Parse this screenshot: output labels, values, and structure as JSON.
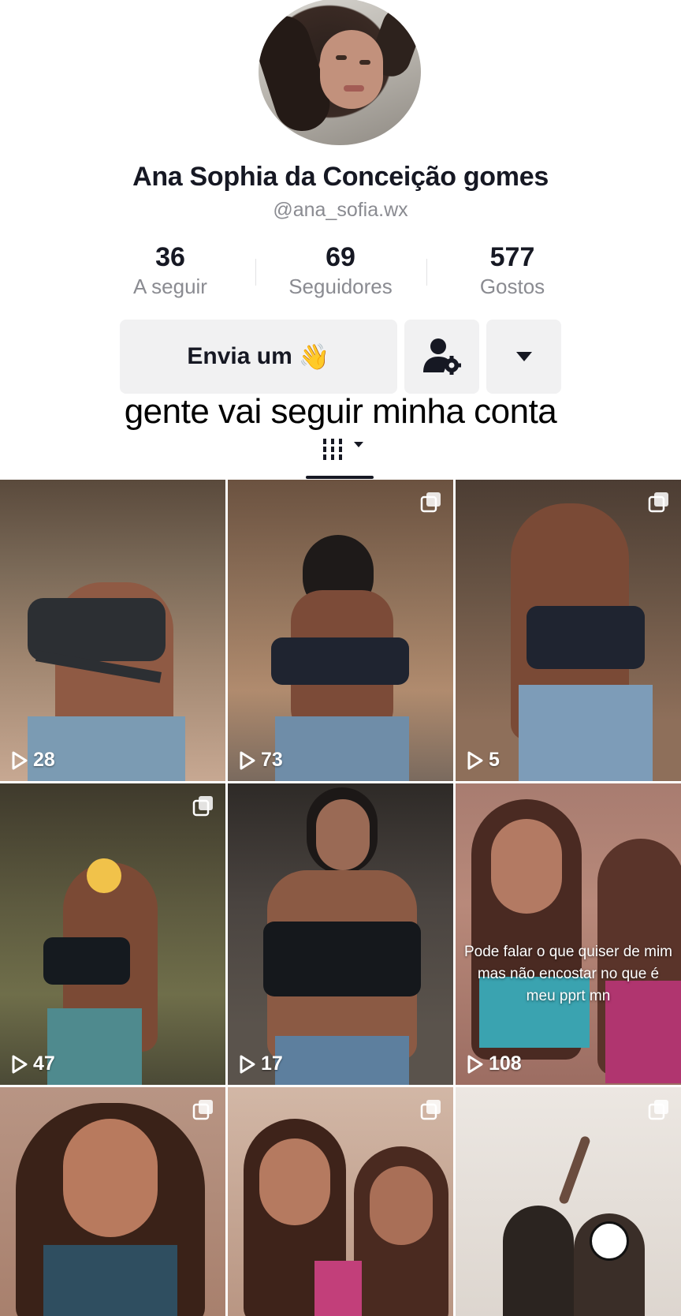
{
  "profile": {
    "name": "Ana Sophia da Conceição gomes",
    "handle": "@ana_sofia.wx",
    "stats": [
      {
        "value": "36",
        "label": "A seguir"
      },
      {
        "value": "69",
        "label": "Seguidores"
      },
      {
        "value": "577",
        "label": "Gostos"
      }
    ]
  },
  "actions": {
    "message_label": "Envia um",
    "message_emoji": "👋",
    "user_settings_icon": "user-gear-icon",
    "more_icon": "caret-down-icon"
  },
  "caption": "gente vai seguir minha conta",
  "videos": [
    {
      "views": "28",
      "multi": false,
      "overlay": ""
    },
    {
      "views": "73",
      "multi": true,
      "overlay": ""
    },
    {
      "views": "5",
      "multi": true,
      "overlay": ""
    },
    {
      "views": "47",
      "multi": true,
      "overlay": ""
    },
    {
      "views": "17",
      "multi": false,
      "overlay": ""
    },
    {
      "views": "108",
      "multi": false,
      "overlay": "Pode falar o que quiser de mim mas não encostar no que é meu pprt mn"
    },
    {
      "views": "",
      "multi": true,
      "overlay": ""
    },
    {
      "views": "",
      "multi": true,
      "overlay": ""
    },
    {
      "views": "",
      "multi": true,
      "overlay": ""
    }
  ]
}
